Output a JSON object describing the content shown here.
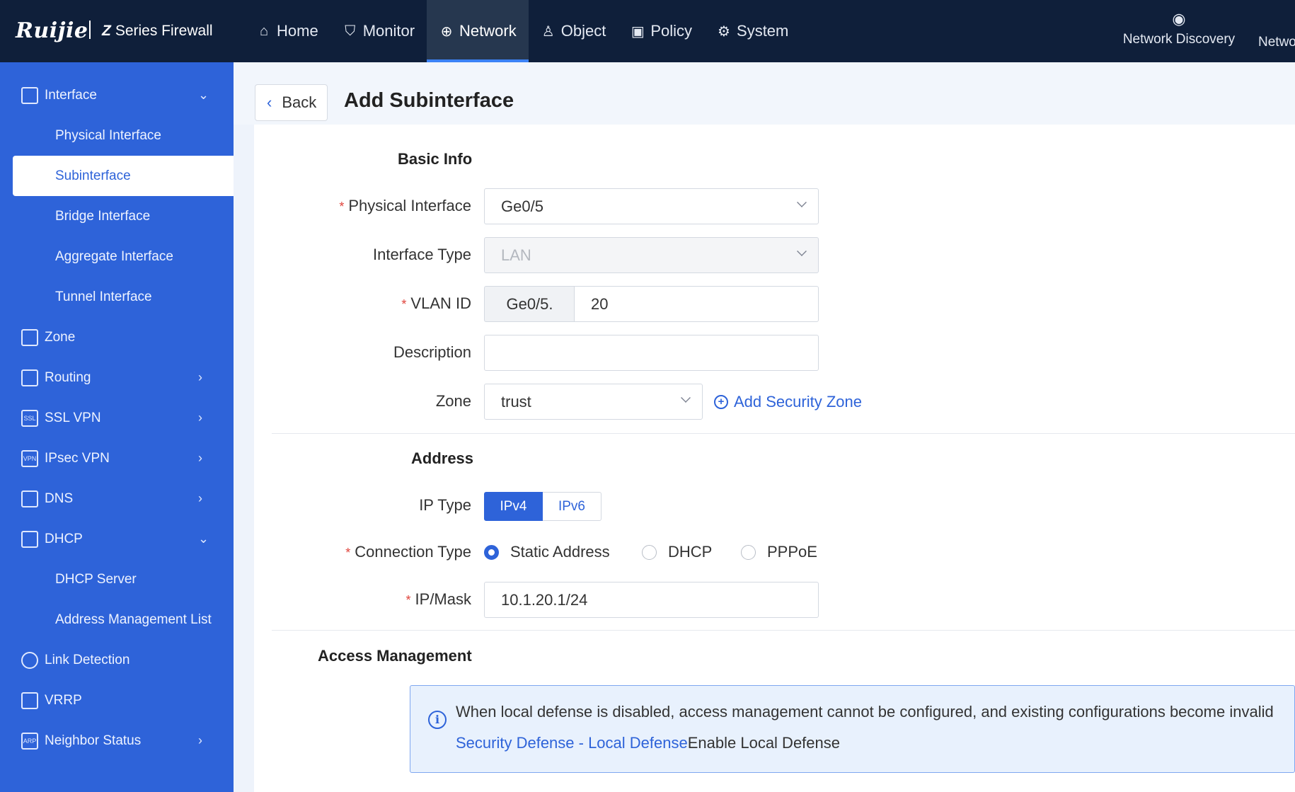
{
  "topbar": {
    "logo": "Ruijie",
    "product": "Series Firewall",
    "product_mark": "Z",
    "nav": [
      {
        "label": "Home",
        "icon": "home-icon"
      },
      {
        "label": "Monitor",
        "icon": "shield-icon"
      },
      {
        "label": "Network",
        "icon": "globe-icon",
        "active": true
      },
      {
        "label": "Object",
        "icon": "user-icon"
      },
      {
        "label": "Policy",
        "icon": "policy-icon"
      },
      {
        "label": "System",
        "icon": "gear-icon"
      }
    ],
    "network_discovery": "Network Discovery",
    "network_truncated": "Netwo"
  },
  "sidebar": {
    "interface": "Interface",
    "physical_interface": "Physical Interface",
    "subinterface": "Subinterface",
    "bridge_interface": "Bridge Interface",
    "aggregate_interface": "Aggregate Interface",
    "tunnel_interface": "Tunnel Interface",
    "zone": "Zone",
    "routing": "Routing",
    "ssl_vpn": "SSL VPN",
    "ipsec_vpn": "IPsec VPN",
    "dns": "DNS",
    "dhcp": "DHCP",
    "dhcp_server": "DHCP Server",
    "address_management_list": "Address Management List",
    "link_detection": "Link Detection",
    "vrrp": "VRRP",
    "neighbor_status": "Neighbor Status"
  },
  "page": {
    "back": "Back",
    "title": "Add Subinterface"
  },
  "basic_info": {
    "section": "Basic Info",
    "physical_interface_label": "Physical Interface",
    "physical_interface_value": "Ge0/5",
    "interface_type_label": "Interface Type",
    "interface_type_value": "LAN",
    "vlan_id_label": "VLAN ID",
    "vlan_prefix": "Ge0/5.",
    "vlan_value": "20",
    "description_label": "Description",
    "description_value": "",
    "zone_label": "Zone",
    "zone_value": "trust",
    "add_security_zone": "Add Security Zone"
  },
  "address": {
    "section": "Address",
    "ip_type_label": "IP Type",
    "ipv4": "IPv4",
    "ipv6": "IPv6",
    "connection_type_label": "Connection Type",
    "static_address": "Static Address",
    "dhcp": "DHCP",
    "pppoe": "PPPoE",
    "ip_mask_label": "IP/Mask",
    "ip_mask_value": "10.1.20.1/24"
  },
  "access_management": {
    "section": "Access Management",
    "notice": "When local defense is disabled, access management cannot be configured, and existing configurations become invalid",
    "link": "Security Defense - Local Defense",
    "link_suffix": "Enable Local Defense"
  },
  "colors": {
    "topbar": "#0f1f3a",
    "sidebar": "#2e63d9",
    "accent": "#2e63d9",
    "required": "#e0443c"
  }
}
